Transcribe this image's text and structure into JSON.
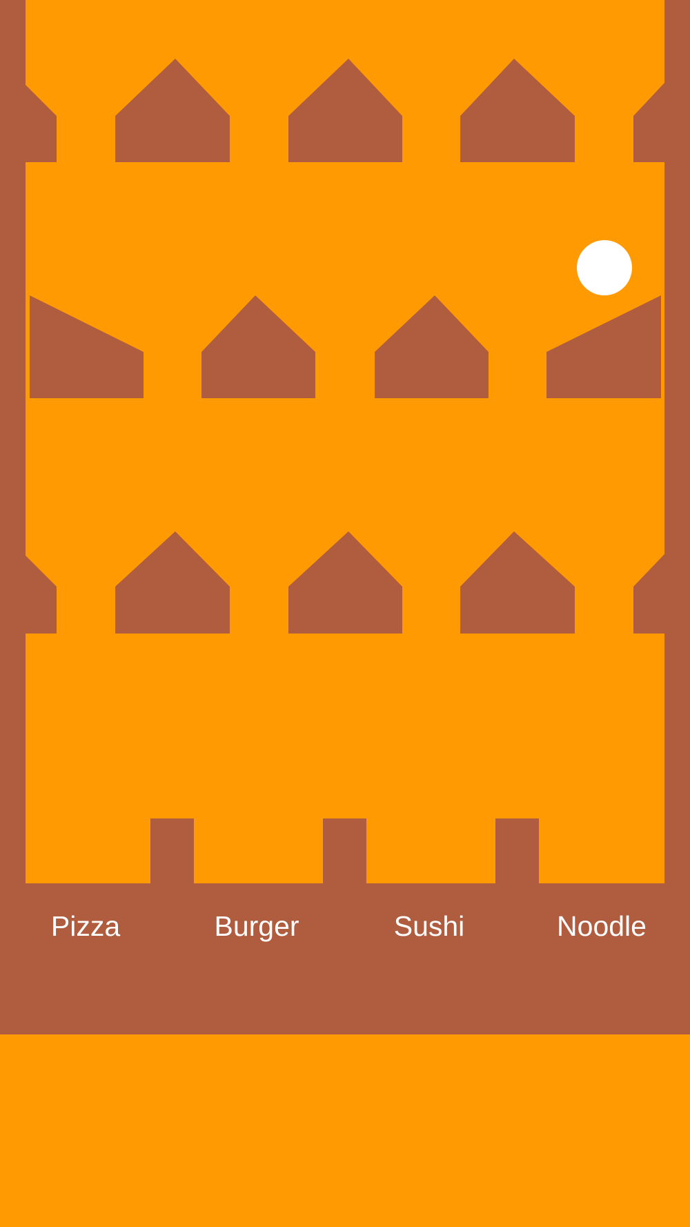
{
  "game": {
    "colors": {
      "background": "#FF9A03",
      "obstacle": "#B05C3E",
      "ball": "#FFFFFF",
      "label": "#FFFFFF"
    },
    "bins": [
      {
        "label": "Pizza"
      },
      {
        "label": "Burger"
      },
      {
        "label": "Sushi"
      },
      {
        "label": "Noodle"
      }
    ]
  }
}
